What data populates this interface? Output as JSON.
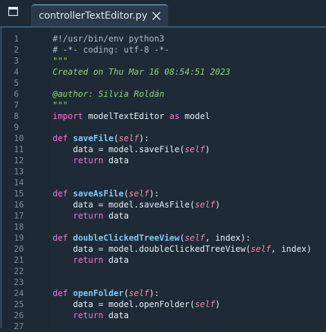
{
  "tabs": [
    {
      "label": "controllerTextEditor.py",
      "active": true
    }
  ],
  "icons": {
    "pane_toggle": "sidebar-toggle-icon",
    "close": "close-icon"
  },
  "colors": {
    "keyword": "#f472d0",
    "function": "#7cc8f5",
    "self": "#f38aa8",
    "docstring": "#8fd46a",
    "comment": "#aebdc9"
  },
  "editor": {
    "lines": [
      {
        "n": "1",
        "tokens": [
          {
            "t": "#!/usr/bin/env python3",
            "c": "comment"
          }
        ]
      },
      {
        "n": "2",
        "tokens": [
          {
            "t": "# -*- coding: utf-8 -*-",
            "c": "comment"
          }
        ]
      },
      {
        "n": "3",
        "tokens": [
          {
            "t": "\"\"\"",
            "c": "doc"
          }
        ]
      },
      {
        "n": "4",
        "tokens": [
          {
            "t": "Created on Thu Mar 16 08:54:51 2023",
            "c": "doc"
          }
        ]
      },
      {
        "n": "5",
        "tokens": []
      },
      {
        "n": "6",
        "tokens": [
          {
            "t": "@author: Silvia Roldán",
            "c": "doc"
          }
        ]
      },
      {
        "n": "7",
        "tokens": [
          {
            "t": "\"\"\"",
            "c": "doc"
          }
        ]
      },
      {
        "n": "8",
        "tokens": [
          {
            "t": "import",
            "c": "kw"
          },
          {
            "t": " modelTextEditor ",
            "c": "plain"
          },
          {
            "t": "as",
            "c": "kw"
          },
          {
            "t": " model",
            "c": "plain"
          }
        ]
      },
      {
        "n": "9",
        "tokens": []
      },
      {
        "n": "10",
        "tokens": [
          {
            "t": "def",
            "c": "kw"
          },
          {
            "t": " ",
            "c": "plain"
          },
          {
            "t": "saveFile",
            "c": "fn"
          },
          {
            "t": "(",
            "c": "plain"
          },
          {
            "t": "self",
            "c": "self"
          },
          {
            "t": "):",
            "c": "plain"
          }
        ]
      },
      {
        "n": "11",
        "tokens": [
          {
            "t": "    data = model.saveFile(",
            "c": "plain"
          },
          {
            "t": "self",
            "c": "self"
          },
          {
            "t": ")",
            "c": "plain"
          }
        ]
      },
      {
        "n": "12",
        "tokens": [
          {
            "t": "    ",
            "c": "plain"
          },
          {
            "t": "return",
            "c": "kw"
          },
          {
            "t": " data",
            "c": "plain"
          }
        ]
      },
      {
        "n": "13",
        "tokens": []
      },
      {
        "n": "14",
        "tokens": []
      },
      {
        "n": "15",
        "tokens": [
          {
            "t": "def",
            "c": "kw"
          },
          {
            "t": " ",
            "c": "plain"
          },
          {
            "t": "saveAsFile",
            "c": "fn"
          },
          {
            "t": "(",
            "c": "plain"
          },
          {
            "t": "self",
            "c": "self"
          },
          {
            "t": "):",
            "c": "plain"
          }
        ]
      },
      {
        "n": "16",
        "tokens": [
          {
            "t": "    data = model.saveAsFile(",
            "c": "plain"
          },
          {
            "t": "self",
            "c": "self"
          },
          {
            "t": ")",
            "c": "plain"
          }
        ]
      },
      {
        "n": "17",
        "tokens": [
          {
            "t": "    ",
            "c": "plain"
          },
          {
            "t": "return",
            "c": "kw"
          },
          {
            "t": " data",
            "c": "plain"
          }
        ]
      },
      {
        "n": "18",
        "tokens": []
      },
      {
        "n": "19",
        "tokens": [
          {
            "t": "def",
            "c": "kw"
          },
          {
            "t": " ",
            "c": "plain"
          },
          {
            "t": "doubleClickedTreeView",
            "c": "fn"
          },
          {
            "t": "(",
            "c": "plain"
          },
          {
            "t": "self",
            "c": "self"
          },
          {
            "t": ", index):",
            "c": "plain"
          }
        ]
      },
      {
        "n": "20",
        "tokens": [
          {
            "t": "    data = model.doubleClickedTreeView(",
            "c": "plain"
          },
          {
            "t": "self",
            "c": "self"
          },
          {
            "t": ", index)",
            "c": "plain"
          }
        ]
      },
      {
        "n": "21",
        "tokens": [
          {
            "t": "    ",
            "c": "plain"
          },
          {
            "t": "return",
            "c": "kw"
          },
          {
            "t": " data",
            "c": "plain"
          }
        ]
      },
      {
        "n": "22",
        "tokens": []
      },
      {
        "n": "23",
        "tokens": []
      },
      {
        "n": "24",
        "tokens": [
          {
            "t": "def",
            "c": "kw"
          },
          {
            "t": " ",
            "c": "plain"
          },
          {
            "t": "openFolder",
            "c": "fn"
          },
          {
            "t": "(",
            "c": "plain"
          },
          {
            "t": "self",
            "c": "self"
          },
          {
            "t": "):",
            "c": "plain"
          }
        ]
      },
      {
        "n": "25",
        "tokens": [
          {
            "t": "    data = model.openFolder(",
            "c": "plain"
          },
          {
            "t": "self",
            "c": "self"
          },
          {
            "t": ")",
            "c": "plain"
          }
        ]
      },
      {
        "n": "26",
        "tokens": [
          {
            "t": "    ",
            "c": "plain"
          },
          {
            "t": "return",
            "c": "kw"
          },
          {
            "t": " data",
            "c": "plain"
          }
        ]
      },
      {
        "n": "27",
        "tokens": []
      }
    ]
  }
}
